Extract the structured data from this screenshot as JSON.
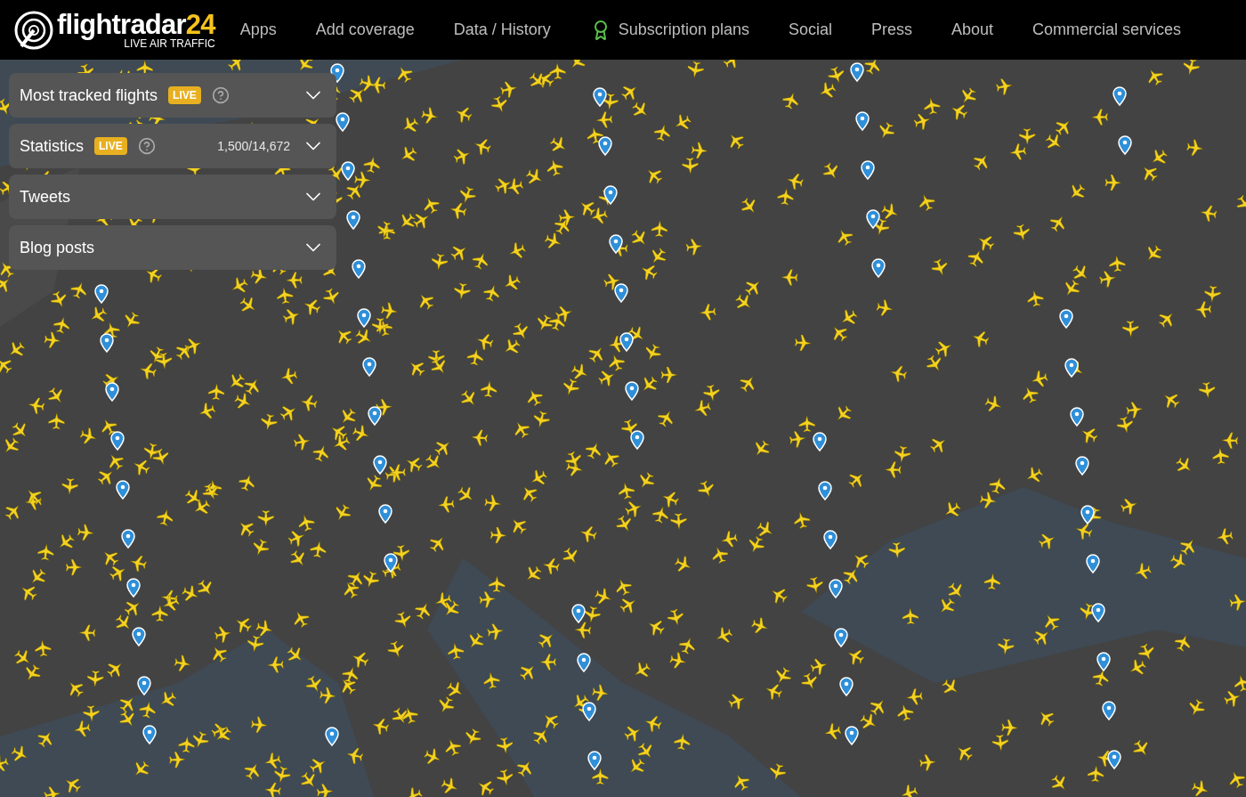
{
  "logo": {
    "name": "flightradar",
    "number": "24",
    "tagline": "LIVE AIR TRAFFIC"
  },
  "nav": [
    {
      "label": "Apps",
      "kind": "plain"
    },
    {
      "label": "Add coverage",
      "kind": "plain"
    },
    {
      "label": "Data / History",
      "kind": "plain"
    },
    {
      "label": "Subscription plans",
      "kind": "award"
    },
    {
      "label": "Social",
      "kind": "plain"
    },
    {
      "label": "Press",
      "kind": "plain"
    },
    {
      "label": "About",
      "kind": "plain"
    },
    {
      "label": "Commercial services",
      "kind": "plain"
    }
  ],
  "panels": [
    {
      "title": "Most tracked flights",
      "badge": "LIVE",
      "help": true,
      "expanded": false
    },
    {
      "title": "Statistics",
      "badge": "LIVE",
      "help": true,
      "count": "1,500/14,672",
      "expanded": false
    },
    {
      "title": "Tweets",
      "help": false,
      "expanded": false
    },
    {
      "title": "Blog posts",
      "help": false,
      "expanded": false
    }
  ]
}
